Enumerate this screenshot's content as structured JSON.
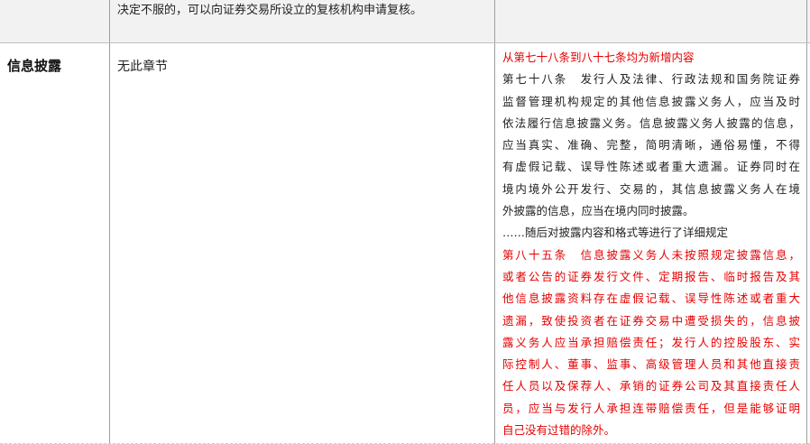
{
  "prev_row": {
    "text": "决定不服的，可以向证券交易所设立的复核机构申请复核。"
  },
  "row": {
    "label": "信息披露",
    "old_text": "无此章节",
    "new_heading": "从第七十八条到八十七条均为新增内容",
    "article78_lines": [
      "第七十八条　发行人及法律、行政法规和国务院证券",
      "监督管理机构规定的其他信息披露义务人，应当及时",
      "依法履行信息披露义务。信息披露义务人披露的信息，",
      "应当真实、准确、完整，简明清晰，通俗易懂，不得",
      "有虚假记载、误导性陈述或者重大遗漏。证券同时在",
      "境内境外公开发行、交易的，其信息披露义务人在境",
      "外披露的信息，应当在境内同时披露。"
    ],
    "note": "……随后对披露内容和格式等进行了详细规定",
    "article85_lines": [
      "第八十五条　信息披露义务人未按照规定披露信息，",
      "或者公告的证券发行文件、定期报告、临时报告及其",
      "他信息披露资料存在虚假记载、误导性陈述或者重大",
      "遗漏，致使投资者在证券交易中遭受损失的，信息披",
      "露义务人应当承担赔偿责任；发行人的控股股东、实",
      "际控制人、董事、监事、高级管理人员和其他直接责",
      "任人员以及保荐人、承销的证券公司及其直接责任人",
      "员，应当与发行人承担连带赔偿责任，但是能够证明",
      "自己没有过错的除外。"
    ]
  },
  "colors": {
    "highlight": "#e60000",
    "header_bg": "#f2f2f2",
    "text": "#222222"
  }
}
